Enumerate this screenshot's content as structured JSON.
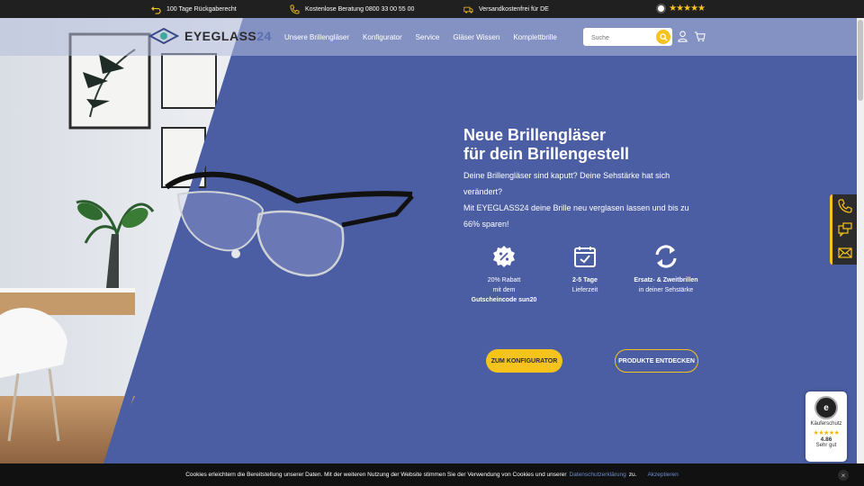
{
  "topbar": {
    "return_text": "100 Tage Rückgaberecht",
    "phone_text": "Kostenlose Beratung 0800 33 00 55 00",
    "shipping_text": "Versandkostenfrei für DE",
    "stars": "★★★★★"
  },
  "header": {
    "logo_main": "EYEGLASS",
    "logo_accent": "24",
    "nav": [
      {
        "label": "Unsere Brillengläser"
      },
      {
        "label": "Konfigurator"
      },
      {
        "label": "Service"
      },
      {
        "label": "Gläser Wissen"
      },
      {
        "label": "Komplettbrille"
      }
    ],
    "search_placeholder": "Suche"
  },
  "hero": {
    "title_line1": "Neue Brillengläser",
    "title_line2": "für dein Brillengestell",
    "text1": "Deine Brillengläser sind kaputt? Deine Sehstärke hat sich verändert?",
    "text2": "Mit EYEGLASS24 deine Brille neu verglasen lassen und bis zu 66% sparen!",
    "features": [
      {
        "icon": "discount-badge-icon",
        "line1": "20% Rabatt",
        "line2": "mit dem",
        "line3": "Gutscheincode sun20"
      },
      {
        "icon": "calendar-check-icon",
        "line1": "2-5 Tage",
        "line2": "Lieferzeit"
      },
      {
        "icon": "refresh-icon",
        "line1": "Ersatz- & Zweitbrillen",
        "line2": "in deiner Sehstärke"
      }
    ],
    "btn_primary": "Zum Konfigurator",
    "btn_secondary": "Produkte entdecken"
  },
  "trust_badge": {
    "seal_letter": "e",
    "label": "Käuferschutz",
    "stars": "★★★★★",
    "score": "4.86",
    "rating_text": "Sehr gut"
  },
  "cookie": {
    "text": "Cookies erleichtern die Bereitstellung unserer Daten. Mit der weiteren Nutzung der Website stimmen Sie der Verwendung von Cookies und unserer",
    "link": "Datenschutzerklärung",
    "suffix": "zu.",
    "accept": "Akzeptieren",
    "close": "×"
  },
  "colors": {
    "accent": "#f6c21c",
    "hero_bg": "#4b5ea4",
    "topbar_bg": "#202020"
  }
}
